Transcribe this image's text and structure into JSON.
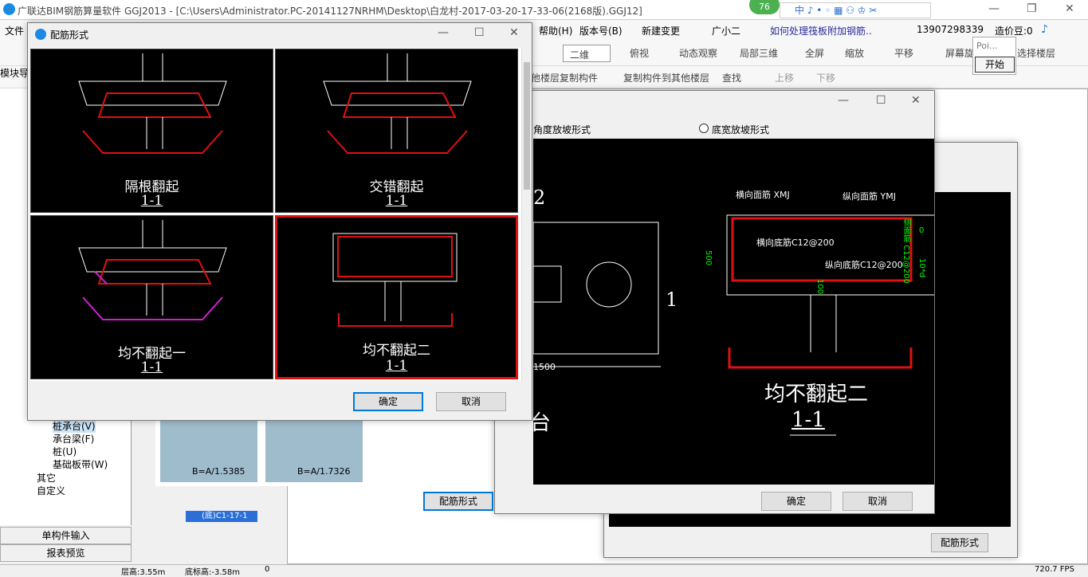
{
  "app": {
    "title": "广联达BIM钢筋算量软件 GGJ2013 - [C:\\Users\\Administrator.PC-20141127NRHM\\Desktop\\白龙村-2017-03-20-17-33-06(2168版).GGJ12]",
    "badge": "76"
  },
  "menu": {
    "file": "文件",
    "help": "帮助(H)",
    "version": "版本号(B)",
    "newchange": "新建变更",
    "guangxiaoer": "广小二",
    "question": "如何处理筏板附加钢筋..",
    "phone": "13907298339",
    "coins": "造价豆:0"
  },
  "toolbar": {
    "view2d": "二维",
    "top": "俯视",
    "dynamic": "动态观察",
    "local3d": "局部三维",
    "fullscreen": "全屏",
    "zoom": "缩放",
    "pan": "平移",
    "rotate": "屏幕旋",
    "floor": "选择楼层"
  },
  "toolbar3": {
    "copyfrom": "他楼层复制构件",
    "copyto": "复制构件到其他楼层",
    "find": "查找",
    "up": "上移",
    "down": "下移"
  },
  "popup": {
    "label": "Poi...",
    "start": "开始"
  },
  "left": {
    "module": "模块导",
    "items": [
      "桩承台(V)",
      "承台梁(F)",
      "桩(U)",
      "基础板带(W)"
    ],
    "others": "其它",
    "custom": "自定义",
    "single": "单构件输入",
    "report": "报表预览"
  },
  "status": {
    "floor_h": "层高:3.55m",
    "bottom_h": "底标高:-3.58m",
    "zero": "0",
    "fps": "720.7 FPS"
  },
  "thumbs": {
    "a": "B=A/1.5385",
    "b": "B=A/1.7326",
    "letter": "A",
    "sel": "(底)C1-17-1"
  },
  "dialog2": {
    "angle": "角度放坡形式",
    "width": "底宽放坡形式",
    "ok": "确定",
    "cancel": "取消",
    "rebar_btn": "配筋形式",
    "dim1500": "1500",
    "num1": "1",
    "num2": "2",
    "rect_label": "矩形承台",
    "cap1": "均不翻起二",
    "cap2": "1-1",
    "xmj": "横向面筋 XMJ",
    "ymj": "纵向面筋 YMJ",
    "xdj": "横向底筋C12@200",
    "ydj": "纵向底筋C12@200",
    "side": "侧面筋 C12@200",
    "d500": "500",
    "d0": "0",
    "d10d": "10*d",
    "d100": "100"
  },
  "dialog3": {
    "rebar_btn": "配筋形式"
  },
  "dialog1": {
    "title": "配筋形式",
    "ok": "确定",
    "cancel": "取消",
    "cells": [
      {
        "name": "隔根翻起",
        "sec": "1-1"
      },
      {
        "name": "交错翻起",
        "sec": "1-1"
      },
      {
        "name": "均不翻起一",
        "sec": "1-1"
      },
      {
        "name": "均不翻起二",
        "sec": "1-1"
      }
    ]
  }
}
